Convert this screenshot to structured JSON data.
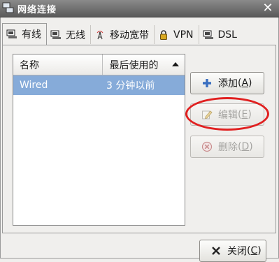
{
  "window": {
    "title": "网络连接",
    "close_glyph": "✕"
  },
  "tabs": [
    {
      "label": "有线",
      "icon": "wired-network-icon",
      "active": true
    },
    {
      "label": "无线",
      "icon": "wireless-network-icon",
      "active": false
    },
    {
      "label": "移动宽带",
      "icon": "mobile-broadband-icon",
      "active": false
    },
    {
      "label": "VPN",
      "icon": "lock-icon",
      "active": false
    },
    {
      "label": "DSL",
      "icon": "dsl-network-icon",
      "active": false
    }
  ],
  "list": {
    "columns": [
      "名称",
      "最后使用的"
    ],
    "sort_column": "最后使用的",
    "rows": [
      {
        "name": "Wired",
        "last_used": "3 分钟以前",
        "selected": true
      }
    ]
  },
  "buttons": {
    "add": {
      "label": "添加",
      "mnemonic": "A",
      "icon": "plus-icon"
    },
    "edit": {
      "label": "编辑",
      "mnemonic": "E",
      "icon": "edit-icon",
      "disabled": true
    },
    "delete": {
      "label": "删除",
      "mnemonic": "D",
      "icon": "delete-icon",
      "disabled": true
    },
    "close": {
      "label": "关闭",
      "mnemonic": "C",
      "icon": "close-icon"
    }
  },
  "colors": {
    "selection": "#86abd9",
    "highlight_circle": "#e02020"
  }
}
